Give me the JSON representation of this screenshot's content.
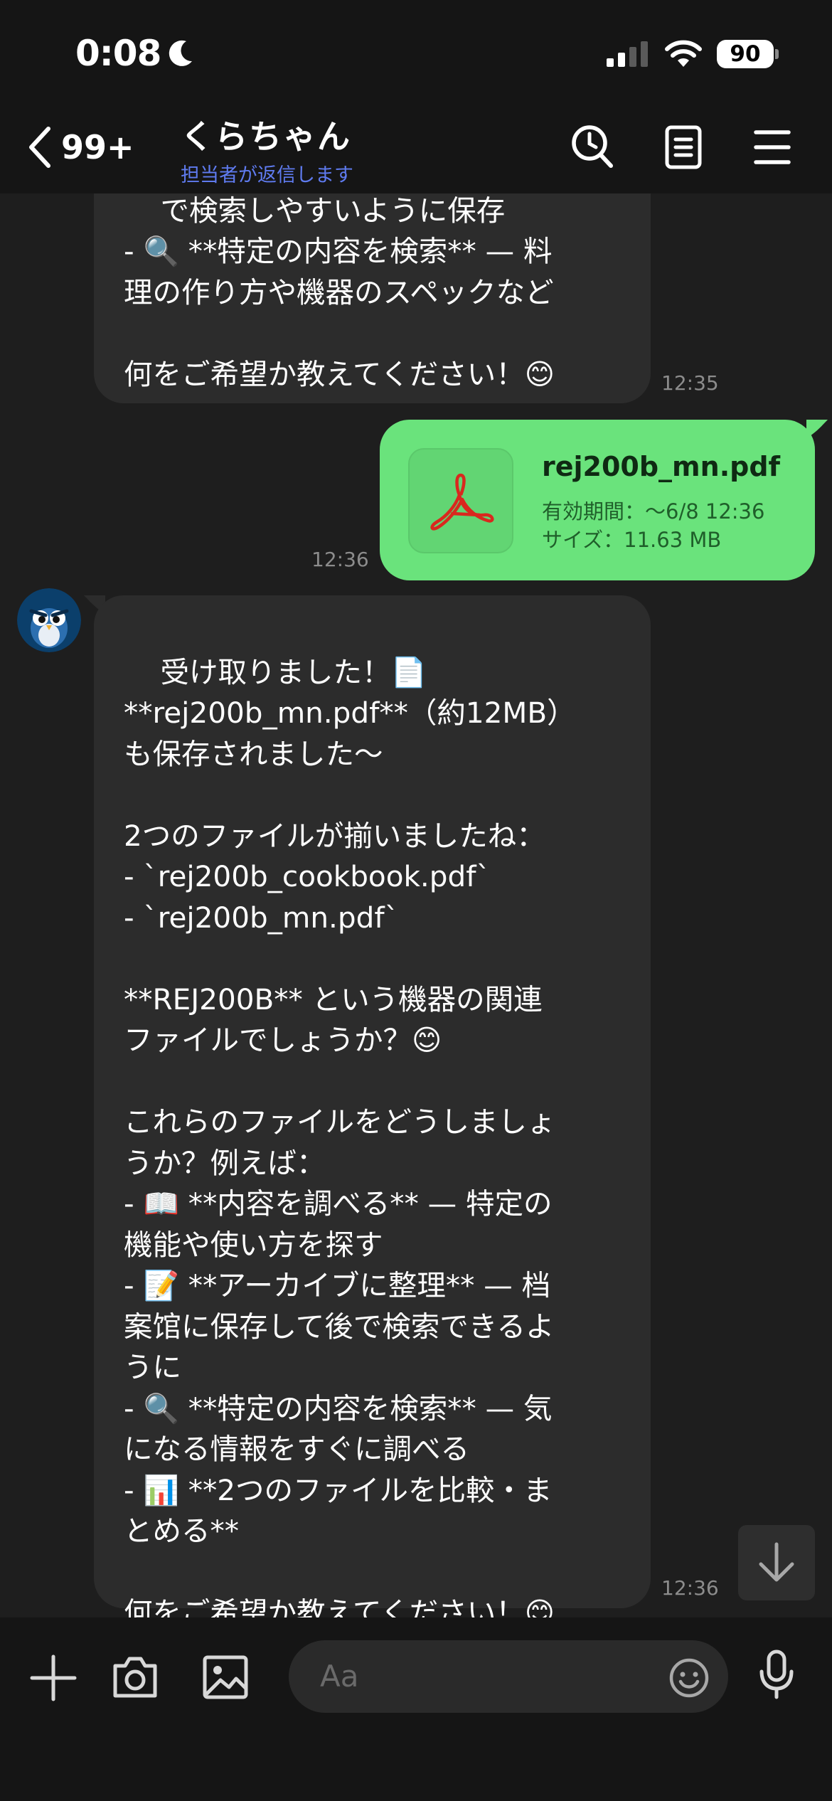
{
  "status_bar": {
    "time": "0:08",
    "battery": "90",
    "icons": [
      "moon-icon",
      "cellular-signal-icon",
      "wifi-icon",
      "battery-icon"
    ]
  },
  "header": {
    "back_count": "99+",
    "chat_name": "くらちゃん",
    "subtitle": "担当者が返信します",
    "icons": [
      "search-icon",
      "notes-icon",
      "menu-icon"
    ]
  },
  "messages": {
    "first": {
      "text": "で検索しやすいように保存\n- 🔍 **特定の内容を検索** — 料\n理の作り方や機器のスペックなど\n\n何をご希望か教えてください！😊",
      "time": "12:35"
    },
    "file": {
      "name": "rej200b_mn.pdf",
      "expiry": "有効期間：～6/8 12:36",
      "size": "サイズ：11.63 MB",
      "time": "12:36"
    },
    "reply": {
      "text": "受け取りました！📄\n**rej200b_mn.pdf**（約12MB）\nも保存されました～\n\n2つのファイルが揃いましたね：\n- `rej200b_cookbook.pdf`\n- `rej200b_mn.pdf`\n\n**REJ200B** という機器の関連\nファイルでしょうか？😊\n\nこれらのファイルをどうしましょ\nうか？例えば：\n- 📖 **内容を調べる** — 特定の\n機能や使い方を探す\n- 📝 **アーカイブに整理** — 档\n案馆に保存して後で検索できるよ\nうに\n- 🔍 **特定の内容を検索** — 気\nになる情報をすぐに調べる\n- 📊 **2つのファイルを比較・ま\nとめる**\n\n何をご希望か教えてください！😊",
      "time": "12:36"
    }
  },
  "input": {
    "placeholder": "Aa"
  },
  "colors": {
    "background": "#1e1e1e",
    "bars": "#151515",
    "incoming_bubble": "#2c2c2c",
    "outgoing_bubble": "#6ae37c",
    "subtitle_accent": "#5f7bf0"
  }
}
